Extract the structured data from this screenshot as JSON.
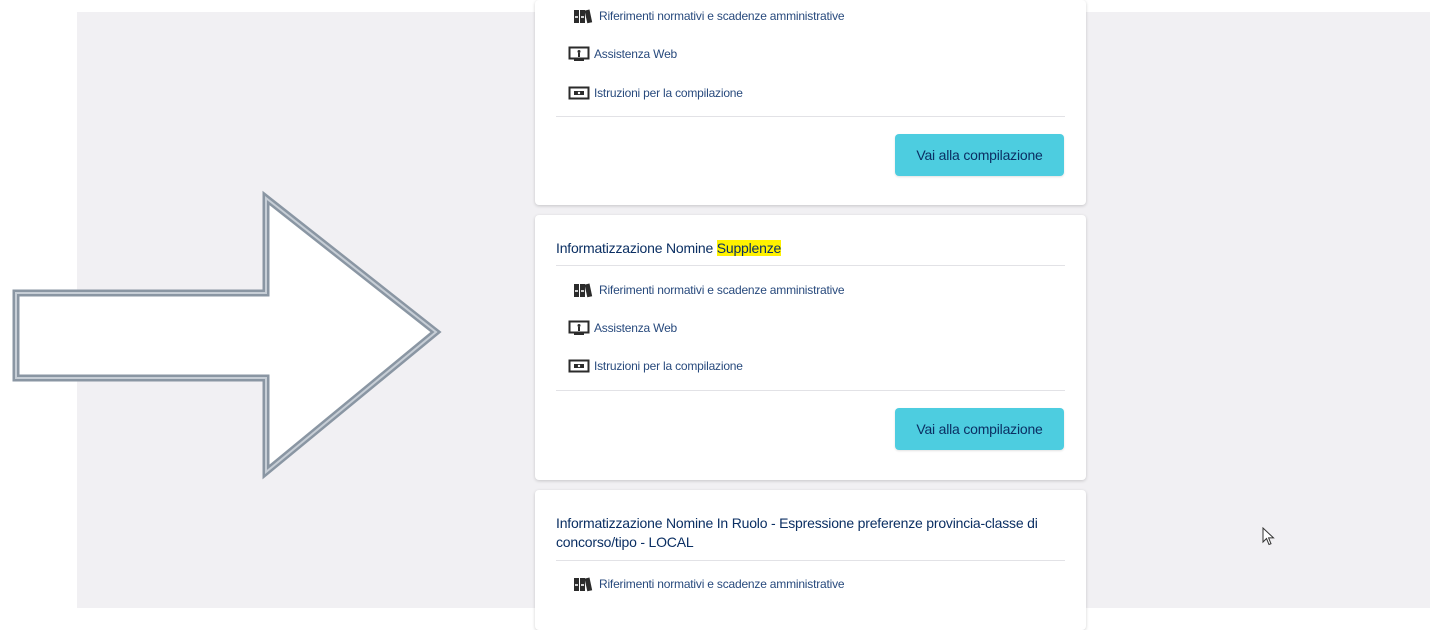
{
  "cards": [
    {
      "title_prefix": "",
      "title_highlight": "",
      "links": [
        {
          "label": "Riferimenti normativi e scadenze amministrative",
          "icon": "binders-icon"
        },
        {
          "label": "Assistenza Web",
          "icon": "monitor-icon"
        },
        {
          "label": "Istruzioni per la compilazione",
          "icon": "instructions-icon"
        }
      ],
      "button": "Vai alla compilazione"
    },
    {
      "title_prefix": "Informatizzazione Nomine ",
      "title_highlight": "Supplenze",
      "links": [
        {
          "label": "Riferimenti normativi e scadenze amministrative",
          "icon": "binders-icon"
        },
        {
          "label": "Assistenza Web",
          "icon": "monitor-icon"
        },
        {
          "label": "Istruzioni per la compilazione",
          "icon": "instructions-icon"
        }
      ],
      "button": "Vai alla compilazione"
    },
    {
      "title_prefix": "Informatizzazione Nomine In Ruolo - Espressione preferenze provincia-classe di concorso/tipo - LOCAL",
      "title_highlight": "",
      "links": [
        {
          "label": "Riferimenti normativi e scadenze amministrative",
          "icon": "binders-icon"
        }
      ]
    }
  ],
  "colors": {
    "accent_button": "#4dcde0",
    "title_text": "#0b2f63",
    "link_text": "#284a7d",
    "highlight": "#fff200",
    "page_background": "#f1f0f3"
  }
}
